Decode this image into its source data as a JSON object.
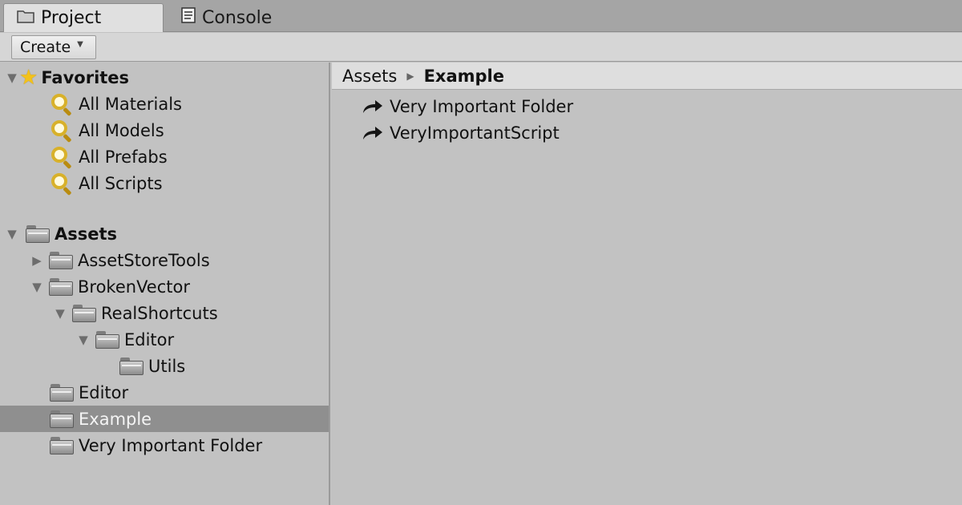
{
  "tabs": {
    "project": "Project",
    "console": "Console"
  },
  "toolbar": {
    "create_label": "Create"
  },
  "favorites": {
    "header": "Favorites",
    "items": [
      "All Materials",
      "All Models",
      "All Prefabs",
      "All Scripts"
    ]
  },
  "assets": {
    "header": "Assets",
    "tree": [
      "AssetStoreTools",
      "BrokenVector",
      "RealShortcuts",
      "Editor",
      "Utils",
      "Editor",
      "Example",
      "Very Important Folder"
    ],
    "selected": "Example"
  },
  "breadcrumb": {
    "root": "Assets",
    "current": "Example"
  },
  "content": {
    "items": [
      "Very Important Folder",
      "VeryImportantScript"
    ]
  },
  "colors": {
    "selection": "#8f8f8f",
    "panel": "#c2c2c2",
    "favorite_star": "#f3c21a"
  }
}
